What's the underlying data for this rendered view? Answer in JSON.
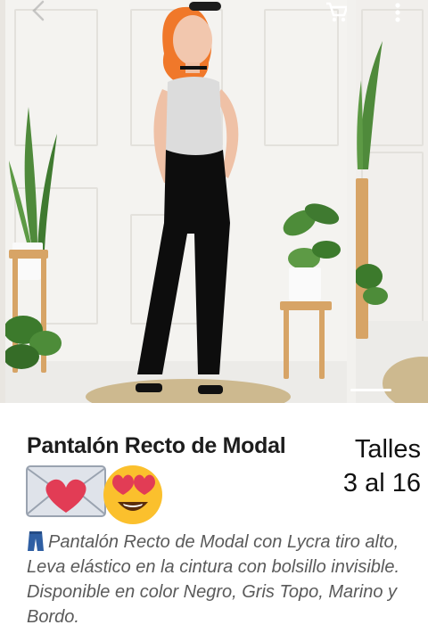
{
  "product": {
    "title": "Pantalón Recto de Modal",
    "sizes_line1": "Talles",
    "sizes_line2": "3 al 16",
    "description": "Pantalón Recto de Modal con Lycra tiro alto, Leva elástico en la cintura con bolsillo invisible. Disponible en color Negro, Gris Topo, Marino y Bordo."
  },
  "icons": {
    "cart": "shopping-cart-icon",
    "more": "more-vert-icon",
    "back": "arrow-back-icon",
    "mail": "love-letter-emoji",
    "face": "heart-eyes-emoji",
    "jeans": "jeans-emoji"
  },
  "colors": {
    "pants": "#0d0d0d",
    "hair": "#f0782a",
    "top": "#dcdcdc",
    "plant": "#4f8a3b",
    "stand": "#d7a466"
  }
}
